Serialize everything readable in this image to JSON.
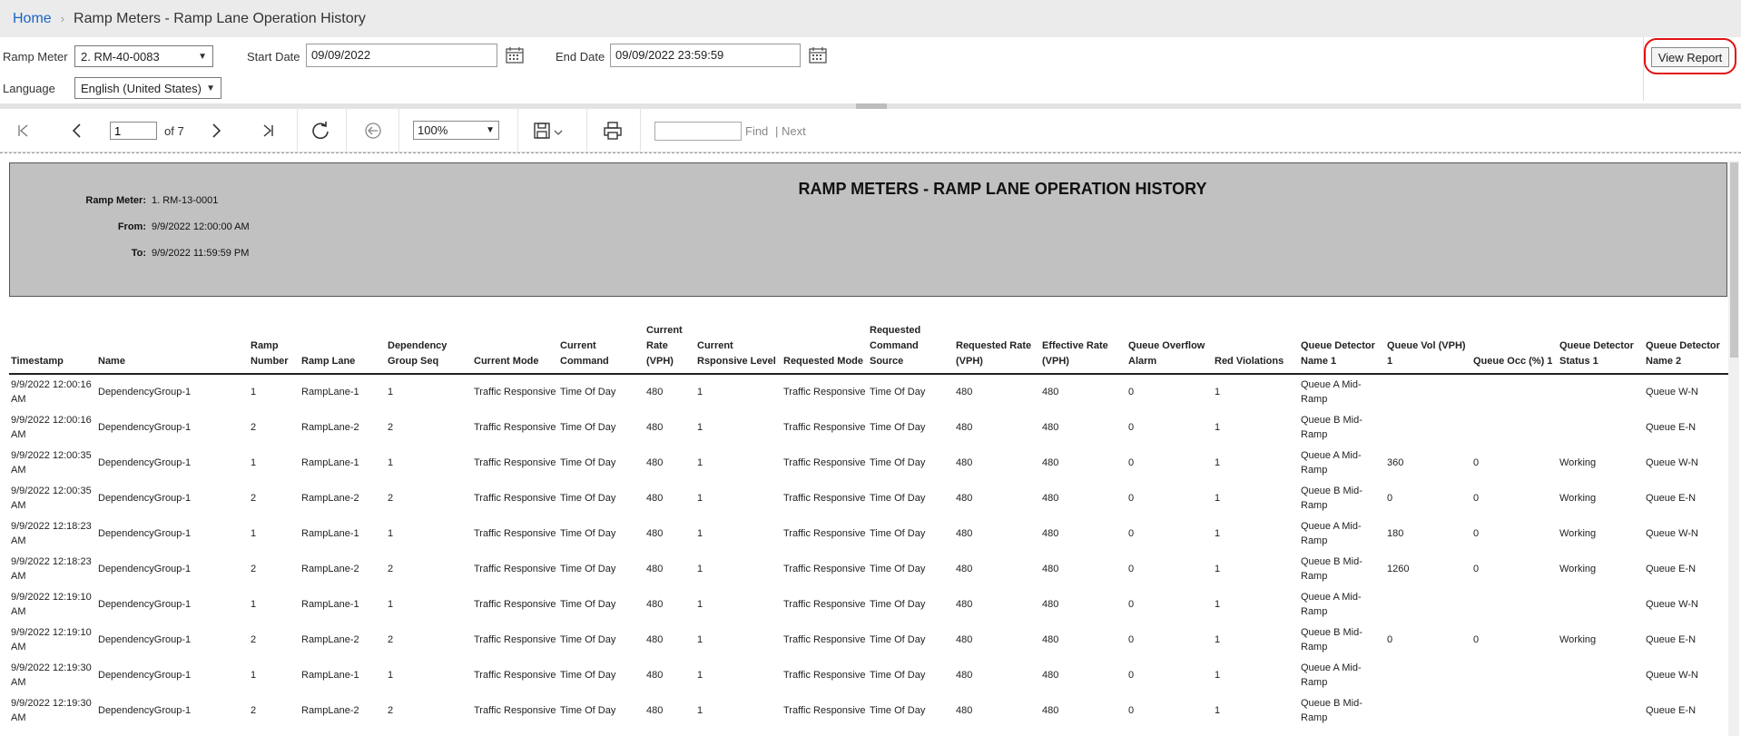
{
  "breadcrumb": {
    "home": "Home",
    "separator": "›",
    "current": "Ramp Meters - Ramp Lane Operation History"
  },
  "params": {
    "ramp_meter_label": "Ramp Meter",
    "ramp_meter_value": "2. RM-40-0083",
    "start_date_label": "Start Date",
    "start_date_value": "09/09/2022",
    "end_date_label": "End Date",
    "end_date_value": "09/09/2022 23:59:59",
    "language_label": "Language",
    "language_value": "English (United States)",
    "view_report": "View Report"
  },
  "toolbar": {
    "page_value": "1",
    "of_label": "of 7",
    "zoom_value": "100%",
    "find_label": "Find",
    "next_label": "| Next"
  },
  "report": {
    "title": "RAMP METERS - RAMP LANE OPERATION HISTORY",
    "ramp_meter_key": "Ramp Meter:",
    "ramp_meter_val": "1. RM-13-0001",
    "from_key": "From:",
    "from_val": "9/9/2022 12:00:00 AM",
    "to_key": "To:",
    "to_val": "9/9/2022 11:59:59 PM",
    "columns": [
      "Timestamp",
      "Name",
      "Ramp Number",
      "Ramp Lane",
      "Dependency Group Seq",
      "Current Mode",
      "Current Command",
      "Current Rate (VPH)",
      "Current Rsponsive Level",
      "Requested Mode",
      "Requested Command Source",
      "Requested Rate (VPH)",
      "Effective Rate (VPH)",
      "Queue Overflow Alarm",
      "Red Violations",
      "Queue Detector Name 1",
      "Queue Vol (VPH) 1",
      "Queue Occ (%) 1",
      "Queue Detector Status 1",
      "Queue Detector Name 2"
    ],
    "rows": [
      [
        "9/9/2022 12:00:16 AM",
        "DependencyGroup-1",
        "1",
        "RampLane-1",
        "1",
        "Traffic Responsive",
        "Time Of Day",
        "480",
        "1",
        "Traffic Responsive",
        "Time Of Day",
        "480",
        "480",
        "0",
        "1",
        "Queue A Mid-Ramp",
        "",
        "",
        "",
        "Queue W-N"
      ],
      [
        "9/9/2022 12:00:16 AM",
        "DependencyGroup-1",
        "2",
        "RampLane-2",
        "2",
        "Traffic Responsive",
        "Time Of Day",
        "480",
        "1",
        "Traffic Responsive",
        "Time Of Day",
        "480",
        "480",
        "0",
        "1",
        "Queue B Mid-Ramp",
        "",
        "",
        "",
        "Queue E-N"
      ],
      [
        "9/9/2022 12:00:35 AM",
        "DependencyGroup-1",
        "1",
        "RampLane-1",
        "1",
        "Traffic Responsive",
        "Time Of Day",
        "480",
        "1",
        "Traffic Responsive",
        "Time Of Day",
        "480",
        "480",
        "0",
        "1",
        "Queue A Mid-Ramp",
        "360",
        "0",
        "Working",
        "Queue W-N"
      ],
      [
        "9/9/2022 12:00:35 AM",
        "DependencyGroup-1",
        "2",
        "RampLane-2",
        "2",
        "Traffic Responsive",
        "Time Of Day",
        "480",
        "1",
        "Traffic Responsive",
        "Time Of Day",
        "480",
        "480",
        "0",
        "1",
        "Queue B Mid-Ramp",
        "0",
        "0",
        "Working",
        "Queue E-N"
      ],
      [
        "9/9/2022 12:18:23 AM",
        "DependencyGroup-1",
        "1",
        "RampLane-1",
        "1",
        "Traffic Responsive",
        "Time Of Day",
        "480",
        "1",
        "Traffic Responsive",
        "Time Of Day",
        "480",
        "480",
        "0",
        "1",
        "Queue A Mid-Ramp",
        "180",
        "0",
        "Working",
        "Queue W-N"
      ],
      [
        "9/9/2022 12:18:23 AM",
        "DependencyGroup-1",
        "2",
        "RampLane-2",
        "2",
        "Traffic Responsive",
        "Time Of Day",
        "480",
        "1",
        "Traffic Responsive",
        "Time Of Day",
        "480",
        "480",
        "0",
        "1",
        "Queue B Mid-Ramp",
        "1260",
        "0",
        "Working",
        "Queue E-N"
      ],
      [
        "9/9/2022 12:19:10 AM",
        "DependencyGroup-1",
        "1",
        "RampLane-1",
        "1",
        "Traffic Responsive",
        "Time Of Day",
        "480",
        "1",
        "Traffic Responsive",
        "Time Of Day",
        "480",
        "480",
        "0",
        "1",
        "Queue A Mid-Ramp",
        "",
        "",
        "",
        "Queue W-N"
      ],
      [
        "9/9/2022 12:19:10 AM",
        "DependencyGroup-1",
        "2",
        "RampLane-2",
        "2",
        "Traffic Responsive",
        "Time Of Day",
        "480",
        "1",
        "Traffic Responsive",
        "Time Of Day",
        "480",
        "480",
        "0",
        "1",
        "Queue B Mid-Ramp",
        "0",
        "0",
        "Working",
        "Queue E-N"
      ],
      [
        "9/9/2022 12:19:30 AM",
        "DependencyGroup-1",
        "1",
        "RampLane-1",
        "1",
        "Traffic Responsive",
        "Time Of Day",
        "480",
        "1",
        "Traffic Responsive",
        "Time Of Day",
        "480",
        "480",
        "0",
        "1",
        "Queue A Mid-Ramp",
        "",
        "",
        "",
        "Queue W-N"
      ],
      [
        "9/9/2022 12:19:30 AM",
        "DependencyGroup-1",
        "2",
        "RampLane-2",
        "2",
        "Traffic Responsive",
        "Time Of Day",
        "480",
        "1",
        "Traffic Responsive",
        "Time Of Day",
        "480",
        "480",
        "0",
        "1",
        "Queue B Mid-Ramp",
        "",
        "",
        "",
        "Queue E-N"
      ]
    ]
  },
  "icons": {
    "first_page": "first-page-icon",
    "prev_page": "prev-page-icon",
    "next_page": "next-page-icon",
    "last_page": "last-page-icon",
    "refresh": "refresh-icon",
    "back": "back-icon",
    "save": "save-icon",
    "print": "print-icon",
    "calendar": "calendar-icon"
  },
  "colors": {
    "link": "#1a64c9",
    "highlight": "#e01010",
    "report_header_bg": "#c1c1c1"
  }
}
